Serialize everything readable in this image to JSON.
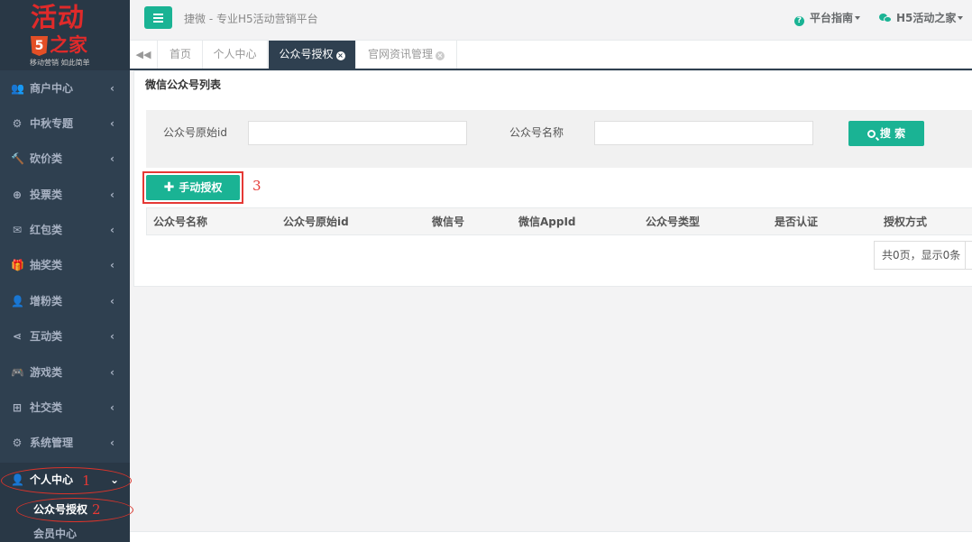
{
  "logo": {
    "line1": "活动",
    "html5_badge": "5",
    "line2": "之家",
    "slogan": "移动营销 如此简单"
  },
  "sidebar": {
    "items": [
      {
        "label": "商户中心",
        "icon": "users-icon",
        "glyph": "👥",
        "arrow": "‹"
      },
      {
        "label": "中秋专题",
        "icon": "gear-circle-icon",
        "glyph": "⚙",
        "arrow": "‹"
      },
      {
        "label": "砍价类",
        "icon": "gavel-icon",
        "glyph": "🔨",
        "arrow": "‹"
      },
      {
        "label": "投票类",
        "icon": "lifebuoy-icon",
        "glyph": "⊕",
        "arrow": "‹"
      },
      {
        "label": "红包类",
        "icon": "envelope-icon",
        "glyph": "✉",
        "arrow": "‹"
      },
      {
        "label": "抽奖类",
        "icon": "gift-icon",
        "glyph": "🎁",
        "arrow": "‹"
      },
      {
        "label": "增粉类",
        "icon": "user-plus-icon",
        "glyph": "👤",
        "arrow": "‹"
      },
      {
        "label": "互动类",
        "icon": "share-icon",
        "glyph": "⋖",
        "arrow": "‹"
      },
      {
        "label": "游戏类",
        "icon": "gamepad-icon",
        "glyph": "🎮",
        "arrow": "‹"
      },
      {
        "label": "社交类",
        "icon": "plus-square-icon",
        "glyph": "⊞",
        "arrow": "‹"
      },
      {
        "label": "系统管理",
        "icon": "gear-icon",
        "glyph": "⚙",
        "arrow": "‹"
      },
      {
        "label": "个人中心",
        "icon": "user-icon",
        "glyph": "👤",
        "arrow": "⌄"
      }
    ],
    "sub_items": [
      {
        "label": "公众号授权"
      },
      {
        "label": "会员中心"
      }
    ]
  },
  "annotations": {
    "n1": "1",
    "n2": "2",
    "n3": "3"
  },
  "topbar": {
    "platform": "捷微 - 专业H5活动营销平台",
    "guide": "平台指南",
    "account": "H5活动之家"
  },
  "tabs": [
    {
      "label": "首页"
    },
    {
      "label": "个人中心"
    },
    {
      "label": "公众号授权"
    },
    {
      "label": "官网资讯管理"
    }
  ],
  "panel": {
    "title": "微信公众号列表",
    "search": {
      "label_id": "公众号原始id",
      "value_id": "",
      "label_name": "公众号名称",
      "value_name": "",
      "button": "搜 索"
    },
    "add_button": "手动授权",
    "columns": [
      "公众号名称",
      "公众号原始id",
      "微信号",
      "微信AppId",
      "公众号类型",
      "是否认证",
      "授权方式"
    ],
    "pager": "共0页，显示0条"
  },
  "colors": {
    "accent": "#1ab394",
    "sidebar_bg": "#2f4050",
    "annotation_red": "#e53935"
  }
}
